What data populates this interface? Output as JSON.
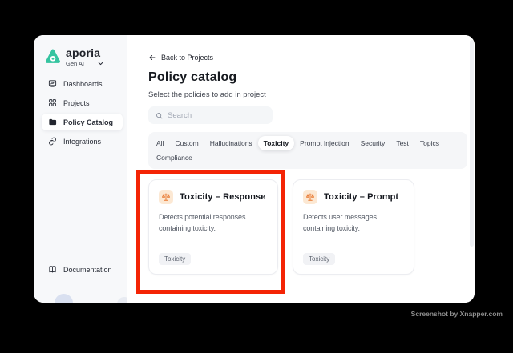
{
  "sidebar": {
    "brand": {
      "name": "aporia",
      "workspace": "Gen AI",
      "logo_icon": "aporia-logo",
      "chevron_icon": "chevron-down-icon"
    },
    "items": [
      {
        "label": "Dashboards",
        "icon": "dashboards-icon",
        "active": false
      },
      {
        "label": "Projects",
        "icon": "projects-icon",
        "active": false
      },
      {
        "label": "Policy Catalog",
        "icon": "policy-catalog-icon",
        "active": true
      },
      {
        "label": "Integrations",
        "icon": "integrations-icon",
        "active": false
      }
    ],
    "footer_item": {
      "label": "Documentation",
      "icon": "documentation-icon"
    }
  },
  "main": {
    "back_link": "Back to Projects",
    "title": "Policy catalog",
    "subtitle": "Select the policies to add in project",
    "search": {
      "placeholder": "Search",
      "icon": "search-icon"
    },
    "tabs": [
      {
        "label": "All",
        "active": false
      },
      {
        "label": "Custom",
        "active": false
      },
      {
        "label": "Hallucinations",
        "active": false
      },
      {
        "label": "Toxicity",
        "active": true
      },
      {
        "label": "Prompt Injection",
        "active": false
      },
      {
        "label": "Security",
        "active": false
      },
      {
        "label": "Test",
        "active": false
      },
      {
        "label": "Topics",
        "active": false
      },
      {
        "label": "Compliance",
        "active": false
      }
    ],
    "cards": [
      {
        "title": "Toxicity – Response",
        "description": "Detects potential responses containing toxicity.",
        "tag": "Toxicity",
        "icon": "scales-icon",
        "highlighted": true
      },
      {
        "title": "Toxicity – Prompt",
        "description": "Detects user messages containing toxicity.",
        "tag": "Toxicity",
        "icon": "scales-icon",
        "highlighted": false
      }
    ]
  },
  "watermark": "Screenshot by Xnapper.com",
  "colors": {
    "brand_teal": "#35c4a0",
    "highlight_red": "#f42405",
    "card_icon_orange": "#e8752c",
    "card_icon_bg": "#fce8d3",
    "sidebar_bg": "#f7f8fa",
    "tabbar_bg": "#f5f6f8"
  }
}
